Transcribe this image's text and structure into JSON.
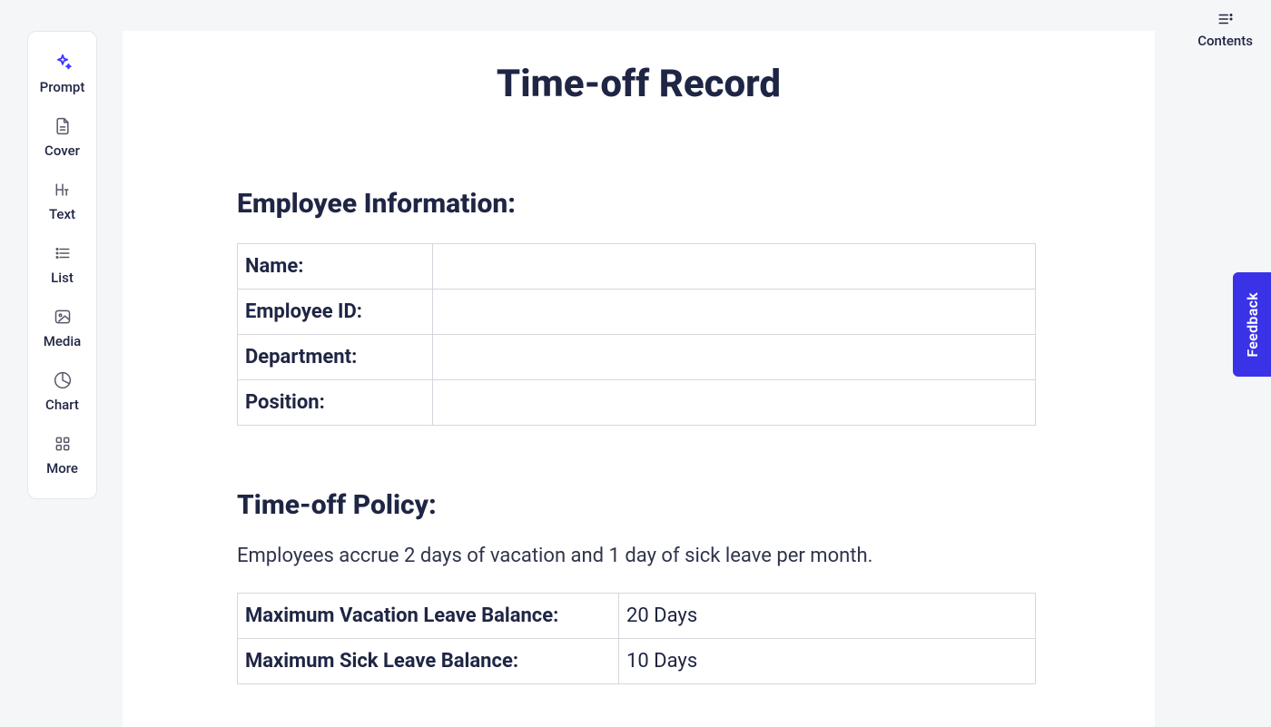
{
  "sidebar": {
    "items": [
      {
        "label": "Prompt"
      },
      {
        "label": "Cover"
      },
      {
        "label": "Text"
      },
      {
        "label": "List"
      },
      {
        "label": "Media"
      },
      {
        "label": "Chart"
      },
      {
        "label": "More"
      }
    ]
  },
  "contents_nav": {
    "label": "Contents"
  },
  "feedback": {
    "label": "Feedback"
  },
  "document": {
    "title": "Time-off Record",
    "sections": {
      "employee_info": {
        "heading": "Employee Information:",
        "rows": [
          {
            "key": "Name:",
            "value": ""
          },
          {
            "key": "Employee ID:",
            "value": ""
          },
          {
            "key": "Department:",
            "value": ""
          },
          {
            "key": "Position:",
            "value": ""
          }
        ]
      },
      "policy": {
        "heading": "Time-off Policy:",
        "description": "Employees accrue 2 days of vacation and 1 day of sick leave per month.",
        "rows": [
          {
            "key": "Maximum Vacation Leave Balance:",
            "value": "20 Days"
          },
          {
            "key": "Maximum Sick Leave Balance:",
            "value": "10 Days"
          }
        ]
      }
    }
  }
}
